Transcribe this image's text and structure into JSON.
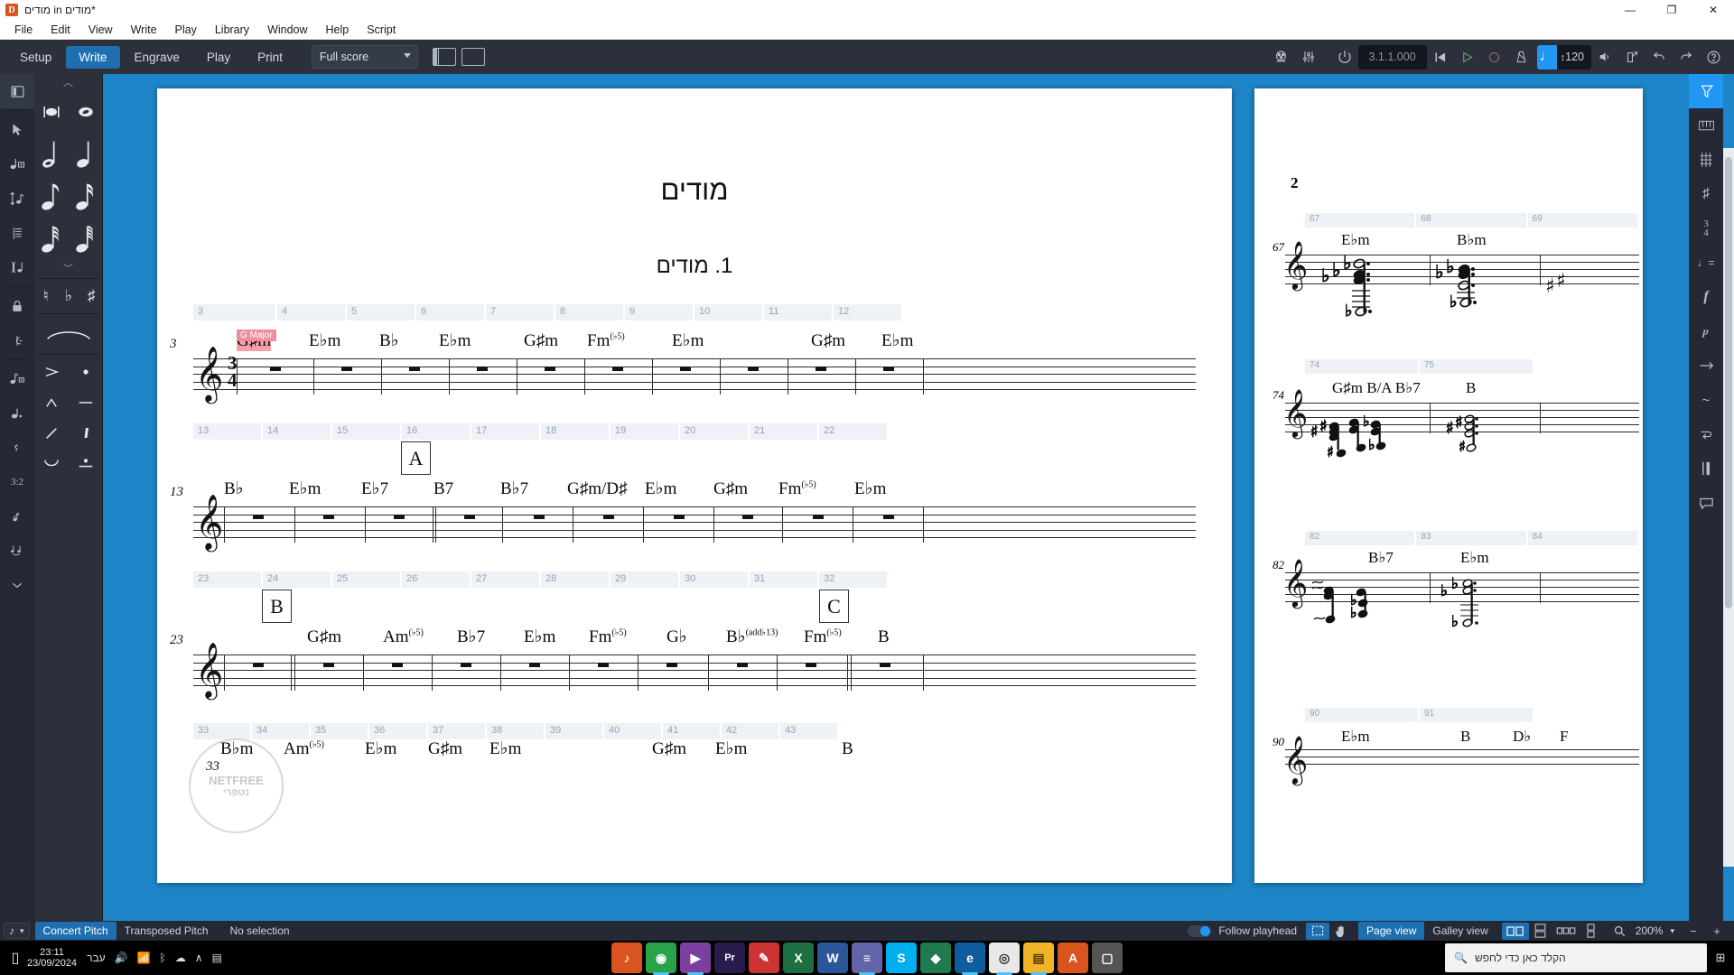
{
  "window": {
    "title": "מודים in מודים*",
    "logo": "D",
    "buttons": {
      "minimize": "—",
      "maximize": "❐",
      "close": "✕"
    }
  },
  "menu": {
    "items": [
      "File",
      "Edit",
      "View",
      "Write",
      "Play",
      "Library",
      "Window",
      "Help",
      "Script"
    ]
  },
  "modebar": {
    "modes": [
      "Setup",
      "Write",
      "Engrave",
      "Play",
      "Print"
    ],
    "active_mode": "Write",
    "layout_selector": "Full score"
  },
  "transport": {
    "position": "3.1.1.000",
    "tempo": "120",
    "icons": [
      "mixer-icon",
      "video-icon",
      "transport-options-icon",
      "power-icon",
      "go-to-start-icon",
      "play-icon",
      "record-icon",
      "metronome-icon",
      "tempo-note-icon",
      "volume-icon",
      "open-external-icon",
      "undo-icon",
      "redo-icon",
      "help-icon"
    ]
  },
  "left_rail": {
    "panel_toggle": "panel-icon",
    "tools": [
      "select-arrow-icon",
      "note-input-icon",
      "transpose-icon",
      "chord-track-icon",
      "insert-icon",
      "lock-duration-icon",
      "grace-note-icon"
    ],
    "secondary": [
      "note-add-icon",
      "dotted-note-icon",
      "rest-icon",
      "tuplet-icon",
      "grace-note-slash-icon",
      "slur-icon"
    ]
  },
  "notes_panel": {
    "durations": [
      "breve",
      "whole",
      "half",
      "quarter",
      "eighth",
      "sixteenth",
      "thirty-second",
      "sixty-fourth"
    ],
    "accidentals": [
      "natural",
      "flat",
      "sharp"
    ],
    "articulations": [
      "accent",
      "staccato",
      "marcato",
      "tenuto",
      "slash",
      "staccatissimo",
      "curve",
      "staccato-tenuto"
    ],
    "tuplet_label": "3:2"
  },
  "score": {
    "title": "מודים",
    "flow_title": "1. מודים",
    "clef": "treble",
    "time_signature": {
      "top": "3",
      "bottom": "4"
    },
    "watermark": {
      "line1": "NETFREE",
      "line2": "נטפרי"
    },
    "systems": [
      {
        "start_measure": "3",
        "bar_numbers": [
          "3",
          "4",
          "5",
          "6",
          "7",
          "8",
          "9",
          "10",
          "11",
          "12"
        ],
        "chords": [
          "G♯m",
          "E♭m",
          "B♭",
          "E♭m",
          "G♯m",
          "Fm(♭5)",
          "E♭m",
          "",
          "G♯m",
          "E♭m"
        ],
        "highlighted_chord_index": 0,
        "chord_tooltip": "G Major",
        "rehearsal_mark": null
      },
      {
        "start_measure": "13",
        "bar_numbers": [
          "13",
          "14",
          "15",
          "16",
          "17",
          "18",
          "19",
          "20",
          "21",
          "22"
        ],
        "chords": [
          "B♭",
          "E♭m",
          "E♭7",
          "B7",
          "B♭7",
          "G♯m/D♯",
          "E♭m",
          "G♯m",
          "Fm(♭5)",
          "E♭m"
        ],
        "rehearsal_mark": {
          "label": "A",
          "bar_index": 3
        }
      },
      {
        "start_measure": "23",
        "bar_numbers": [
          "23",
          "24",
          "25",
          "26",
          "27",
          "28",
          "29",
          "30",
          "31",
          "32"
        ],
        "chords": [
          "",
          "G♯m",
          "Am(♭5)",
          "B♭7",
          "E♭m",
          "Fm(♭5)",
          "G♭",
          "B♭(add♭13)",
          "Fm(♭5)",
          "B"
        ],
        "rehearsal_marks": [
          {
            "label": "B",
            "bar_index": 1
          },
          {
            "label": "C",
            "bar_index": 9
          }
        ]
      },
      {
        "start_measure": "33",
        "bar_numbers": [
          "33",
          "34",
          "35",
          "36",
          "37",
          "38",
          "39",
          "40",
          "41",
          "42",
          "43"
        ],
        "chords": [
          "B♭m",
          "Am(♭5)",
          "E♭m",
          "G♯m",
          "E♭m",
          "",
          "G♯m",
          "E♭m",
          "",
          "B"
        ]
      }
    ]
  },
  "page2": {
    "page_number": "2",
    "systems": [
      {
        "start_measure": "67",
        "bar_numbers": [
          "67",
          "68",
          "69"
        ],
        "chords": [
          "E♭m",
          "B♭m"
        ]
      },
      {
        "start_measure": "74",
        "bar_numbers": [
          "74",
          "75"
        ],
        "chords": [
          "G♯m B/A B♭7",
          "B"
        ]
      },
      {
        "start_measure": "82",
        "bar_numbers": [
          "82",
          "83",
          "84"
        ],
        "chords": [
          "B♭7",
          "E♭m"
        ]
      },
      {
        "start_measure": "90",
        "bar_numbers": [
          "90",
          "91"
        ],
        "chords": [
          "E♭m",
          "B",
          "D♭",
          "F"
        ]
      }
    ]
  },
  "right_rail": {
    "items": [
      "properties-icon",
      "keyboard-icon",
      "fretboard-icon",
      "accidentals-icon",
      "time-signature-icon",
      "tempo-icon",
      "dynamics-icon",
      "playing-techniques-icon",
      "lines-icon",
      "ornaments-icon",
      "repeats-icon",
      "barlines-icon",
      "comments-icon"
    ],
    "selected": "properties-icon"
  },
  "statusbar": {
    "note_tool": "note-icon",
    "pitch_modes": [
      "Concert Pitch",
      "Transposed Pitch"
    ],
    "active_pitch_mode": "Concert Pitch",
    "selection": "No selection",
    "follow_playhead": "Follow playhead",
    "view_modes": [
      "Page view",
      "Galley view"
    ],
    "active_view_mode": "Page view",
    "page_arrangements": [
      "spreads-icon",
      "vertical-icon",
      "horizontal-icon",
      "single-icon"
    ],
    "zoom": "200%",
    "zoom_out": "−",
    "zoom_in": "+"
  },
  "taskbar": {
    "time": "23:11",
    "date": "23/09/2024",
    "language": "עבר",
    "search_placeholder": "הקלד כאן כדי לחפש",
    "apps": [
      {
        "name": "dorico",
        "glyph": "♪",
        "color": "#d9541e",
        "running": false
      },
      {
        "name": "chrome-canary",
        "glyph": "◉",
        "color": "#2aa24a",
        "running": true
      },
      {
        "name": "media-player",
        "glyph": "▶",
        "color": "#7b3fa0",
        "running": true
      },
      {
        "name": "premiere",
        "glyph": "Pr",
        "color": "#2a1b4d",
        "running": false
      },
      {
        "name": "paint",
        "glyph": "✎",
        "color": "#d44",
        "running": false
      },
      {
        "name": "excel",
        "glyph": "X",
        "color": "#1d6f42",
        "running": false
      },
      {
        "name": "word",
        "glyph": "W",
        "color": "#2b579a",
        "running": false
      },
      {
        "name": "teams",
        "glyph": "≡",
        "color": "#6264a7",
        "running": true
      },
      {
        "name": "skype",
        "glyph": "S",
        "color": "#00aff0",
        "running": false
      },
      {
        "name": "maps",
        "glyph": "◆",
        "color": "#1f7a4d",
        "running": false
      },
      {
        "name": "edge",
        "glyph": "e",
        "color": "#0f5c9e",
        "running": true
      },
      {
        "name": "chrome",
        "glyph": "◎",
        "color": "#e8e8e8",
        "running": true
      },
      {
        "name": "explorer",
        "glyph": "▤",
        "color": "#f0b429",
        "running": true
      },
      {
        "name": "acrobat",
        "glyph": "A",
        "color": "#d9541e",
        "running": false
      },
      {
        "name": "notepad",
        "glyph": "▢",
        "color": "#555",
        "running": false
      }
    ]
  }
}
